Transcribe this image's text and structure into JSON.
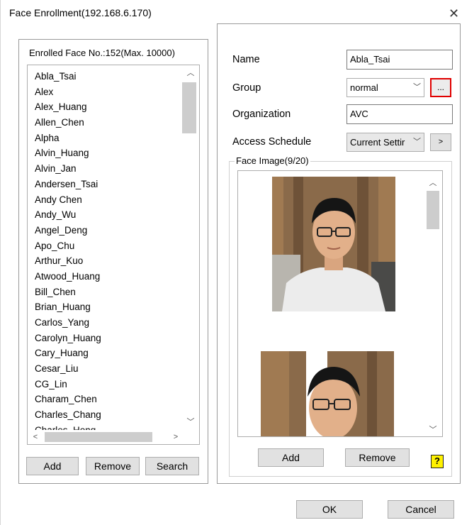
{
  "window": {
    "title": "Face Enrollment(192.168.6.170)",
    "close_symbol": "✕"
  },
  "enrolled": {
    "caption": "Enrolled Face No.:152(Max. 10000)",
    "items": [
      "Abla_Tsai",
      "Alex",
      "Alex_Huang",
      "Allen_Chen",
      "Alpha",
      "Alvin_Huang",
      "Alvin_Jan",
      "Andersen_Tsai",
      "Andy Chen",
      "Andy_Wu",
      "Angel_Deng",
      "Apo_Chu",
      "Arthur_Kuo",
      "Atwood_Huang",
      "Bill_Chen",
      "Brian_Huang",
      "Carlos_Yang",
      "Carolyn_Huang",
      "Cary_Huang",
      "Cesar_Liu",
      "CG_Lin",
      "Charam_Chen",
      "Charles_Chang",
      "Charles_Hong"
    ],
    "buttons": {
      "add": "Add",
      "remove": "Remove",
      "search": "Search"
    }
  },
  "details": {
    "name_label": "Name",
    "name_value": "Abla_Tsai",
    "group_label": "Group",
    "group_value": "normal",
    "group_more": "...",
    "org_label": "Organization",
    "org_value": "AVC",
    "schedule_label": "Access Schedule",
    "schedule_value": "Current Settir",
    "schedule_next": ">"
  },
  "face_image": {
    "caption": "Face Image(9/20)",
    "add": "Add",
    "remove": "Remove",
    "help": "?"
  },
  "footer": {
    "ok": "OK",
    "cancel": "Cancel"
  },
  "icons": {
    "scroll_up": "▲",
    "scroll_down": "▼",
    "scroll_left": "◀",
    "scroll_right": "▶",
    "chevron": "⌄"
  },
  "colors": {
    "highlight_border": "#e00000",
    "help_icon_bg": "#fff200",
    "button_bg": "#e1e1e1"
  }
}
